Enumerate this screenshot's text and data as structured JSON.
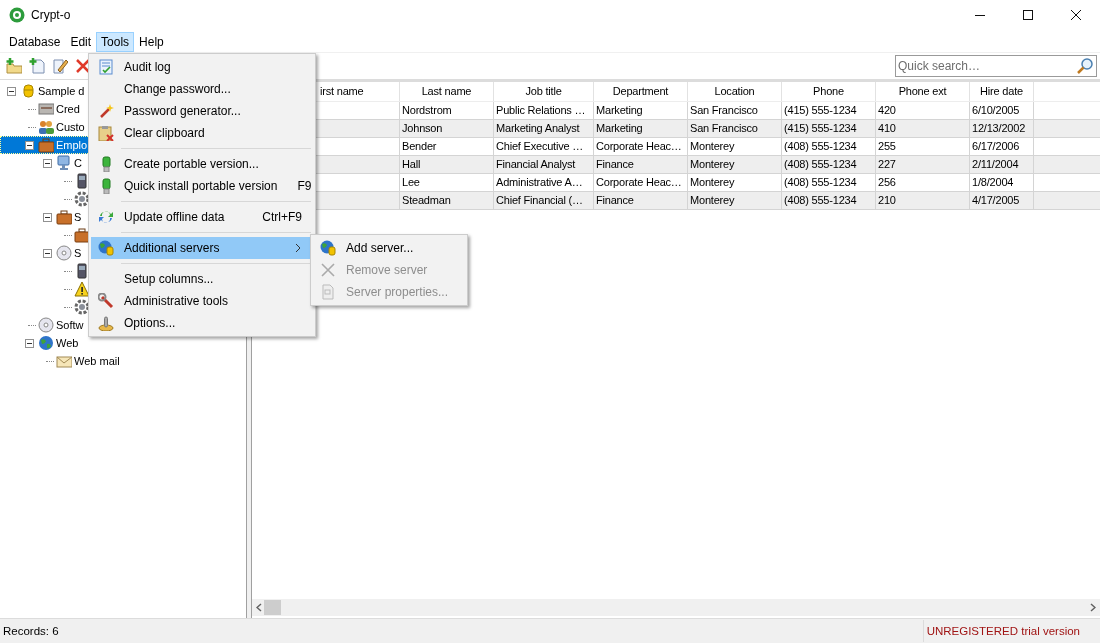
{
  "window": {
    "title": "Crypt-o"
  },
  "menu_bar": [
    {
      "label": "Database",
      "selected": false
    },
    {
      "label": "Edit",
      "selected": false
    },
    {
      "label": "Tools",
      "selected": true
    },
    {
      "label": "Help",
      "selected": false
    }
  ],
  "toolbar": [
    {
      "kind": "add-folder"
    },
    {
      "kind": "add-item"
    },
    {
      "kind": "edit"
    },
    {
      "kind": "delete"
    }
  ],
  "search": {
    "placeholder": "Quick search…"
  },
  "tree": [
    {
      "kind": "database",
      "label": "Sample d",
      "expanded": true,
      "selected": false,
      "children": [
        {
          "kind": "card",
          "label": "Cred",
          "selected": false
        },
        {
          "kind": "people",
          "label": "Custo",
          "selected": false
        },
        {
          "kind": "briefcase",
          "label": "Emplo",
          "expanded": true,
          "selected": true,
          "children": [
            {
              "kind": "computer",
              "label": "C",
              "expanded": true,
              "selected": false,
              "children": [
                {
                  "kind": "phone",
                  "selected": false
                },
                {
                  "kind": "gear",
                  "selected": false
                }
              ]
            },
            {
              "kind": "briefcase",
              "label": "S",
              "expanded": true,
              "selected": false,
              "children": [
                {
                  "kind": "briefcase",
                  "selected": false
                }
              ]
            },
            {
              "kind": "cd",
              "label": "S",
              "expanded": true,
              "selected": false,
              "children": [
                {
                  "kind": "phone",
                  "selected": false
                },
                {
                  "kind": "warning",
                  "selected": false
                },
                {
                  "kind": "gear",
                  "selected": false
                }
              ]
            }
          ]
        },
        {
          "kind": "cd",
          "label": "Softw",
          "selected": false
        },
        {
          "kind": "globe",
          "label": "Web",
          "expanded": true,
          "selected": false,
          "children": [
            {
              "kind": "mail",
              "label": "Web mail",
              "selected": false
            }
          ]
        }
      ]
    }
  ],
  "table": {
    "columns": [
      "irst name",
      "Last name",
      "Job title",
      "Department",
      "Location",
      "Phone",
      "Phone ext",
      "Hire date"
    ],
    "rows": [
      [
        "",
        "Nordstrom",
        "Public Relations …",
        "Marketing",
        "San Francisco",
        "(415) 555-1234",
        "420",
        "6/10/2005"
      ],
      [
        "",
        "Johnson",
        "Marketing Analyst",
        "Marketing",
        "San Francisco",
        "(415) 555-1234",
        "410",
        "12/13/2002"
      ],
      [
        "",
        "Bender",
        "Chief Executive …",
        "Corporate Heac…",
        "Monterey",
        "(408) 555-1234",
        "255",
        "6/17/2006"
      ],
      [
        "",
        "Hall",
        "Financial Analyst",
        "Finance",
        "Monterey",
        "(408) 555-1234",
        "227",
        "2/11/2004"
      ],
      [
        "",
        "Lee",
        "Administrative A…",
        "Corporate Heac…",
        "Monterey",
        "(408) 555-1234",
        "256",
        "1/8/2004"
      ],
      [
        "",
        "Steadman",
        "Chief Financial (…",
        "Finance",
        "Monterey",
        "(408) 555-1234",
        "210",
        "4/17/2005"
      ]
    ]
  },
  "menu": {
    "items": [
      {
        "kind": "item",
        "label": "Audit log",
        "selected": false
      },
      {
        "kind": "item",
        "label": "Change password...",
        "selected": false
      },
      {
        "kind": "item",
        "label": "Password generator...",
        "selected": false
      },
      {
        "kind": "item",
        "label": "Clear clipboard",
        "selected": false
      },
      {
        "kind": "separator"
      },
      {
        "kind": "item",
        "label": "Create portable version...",
        "selected": false
      },
      {
        "kind": "item",
        "label": "Quick install portable version",
        "shortcut": "F9",
        "selected": false
      },
      {
        "kind": "separator"
      },
      {
        "kind": "item",
        "label": "Update offline data",
        "shortcut": "Ctrl+F9",
        "selected": false
      },
      {
        "kind": "separator"
      },
      {
        "kind": "submenu",
        "label": "Additional servers",
        "selected": true
      },
      {
        "kind": "separator"
      },
      {
        "kind": "item",
        "label": "Setup columns...",
        "selected": false
      },
      {
        "kind": "item",
        "label": "Administrative tools",
        "selected": false
      },
      {
        "kind": "item",
        "label": "Options...",
        "selected": false
      }
    ]
  },
  "submenu": {
    "items": [
      {
        "label": "Add server...",
        "disabled": false
      },
      {
        "label": "Remove server",
        "disabled": true
      },
      {
        "label": "Server properties...",
        "disabled": true
      }
    ]
  },
  "status_bar": {
    "records": "Records: 6",
    "license": "UNREGISTERED trial version"
  }
}
